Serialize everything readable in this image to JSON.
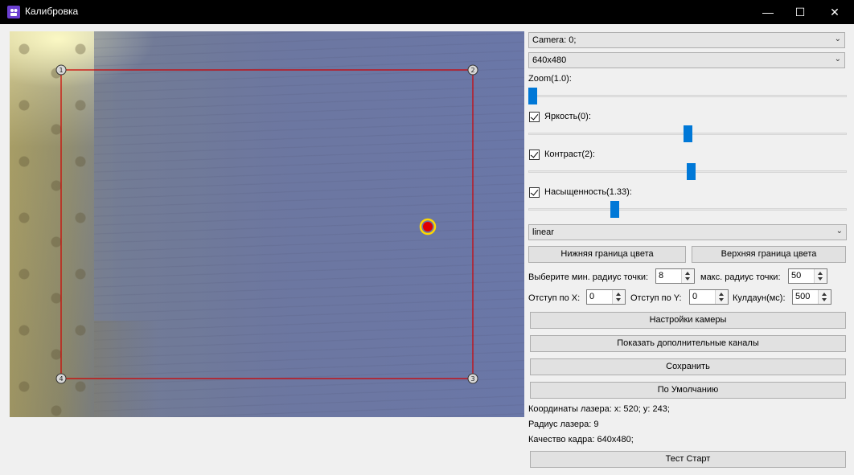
{
  "window": {
    "title": "Калибровка",
    "minimize_glyph": "—",
    "maximize_glyph": "☐",
    "close_glyph": "✕"
  },
  "camera_view": {
    "frame_color": "#d00000",
    "corners": [
      "1",
      "2",
      "3",
      "4"
    ],
    "laser_dot_color": "#e00000",
    "laser_ring_color": "#ffd800"
  },
  "controls": {
    "camera_select": "Camera: 0;",
    "resolution_select": "640x480",
    "zoom_label": "Zoom(1.0):",
    "zoom_level": 0.0,
    "brightness": {
      "checked": true,
      "label": "Яркость(0):",
      "level": 0.5
    },
    "contrast": {
      "checked": true,
      "label": "Контраст(2):",
      "level": 0.51
    },
    "saturation": {
      "checked": true,
      "label": "Насыщенность(1.33):",
      "level": 0.27
    },
    "interpolation_select": "linear",
    "lower_color_button": "Нижняя граница цвета",
    "upper_color_button": "Верхняя граница цвета",
    "min_radius_label": "Выберите мин. радиус точки:",
    "min_radius_value": "8",
    "max_radius_label": "макс. радиус точки:",
    "max_radius_value": "50",
    "offset_x_label": "Отступ по X:",
    "offset_x_value": "0",
    "offset_y_label": "Отступ по Y:",
    "offset_y_value": "0",
    "cooldown_label": "Кулдаун(мс):",
    "cooldown_value": "500",
    "camera_settings_button": "Настройки камеры",
    "show_channels_button": "Показать дополнительные каналы",
    "save_button": "Сохранить",
    "default_button": "По Умолчанию",
    "laser_coords_text": "Координаты лазера: x: 520; y: 243;",
    "laser_radius_text": "Радиус лазера: 9",
    "frame_quality_text": "Качество кадра: 640x480;",
    "test_start_button": "Тест Старт"
  }
}
